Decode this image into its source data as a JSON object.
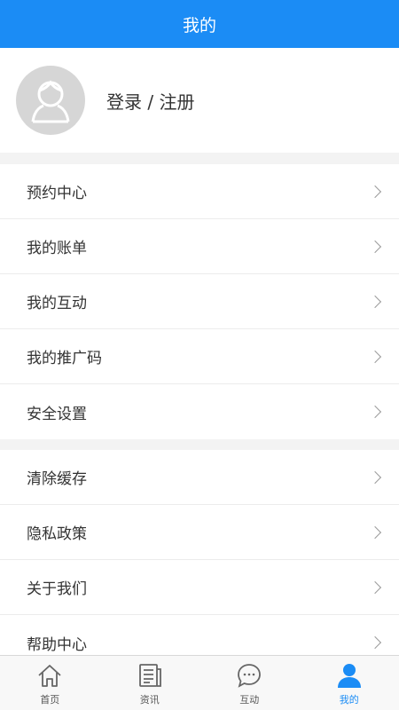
{
  "header": {
    "title": "我的"
  },
  "profile": {
    "login_label": "登录 / 注册"
  },
  "menu_groups": [
    {
      "items": [
        {
          "label": "预约中心"
        },
        {
          "label": "我的账单"
        },
        {
          "label": "我的互动"
        },
        {
          "label": "我的推广码"
        },
        {
          "label": "安全设置"
        }
      ]
    },
    {
      "items": [
        {
          "label": "清除缓存"
        },
        {
          "label": "隐私政策"
        },
        {
          "label": "关于我们"
        },
        {
          "label": "帮助中心"
        }
      ]
    }
  ],
  "tabbar": {
    "tabs": [
      {
        "label": "首页",
        "icon": "home-icon"
      },
      {
        "label": "资讯",
        "icon": "news-icon"
      },
      {
        "label": "互动",
        "icon": "chat-icon"
      },
      {
        "label": "我的",
        "icon": "user-icon",
        "active": true
      }
    ]
  },
  "colors": {
    "accent": "#1b8cf5",
    "background": "#f3f3f3"
  }
}
